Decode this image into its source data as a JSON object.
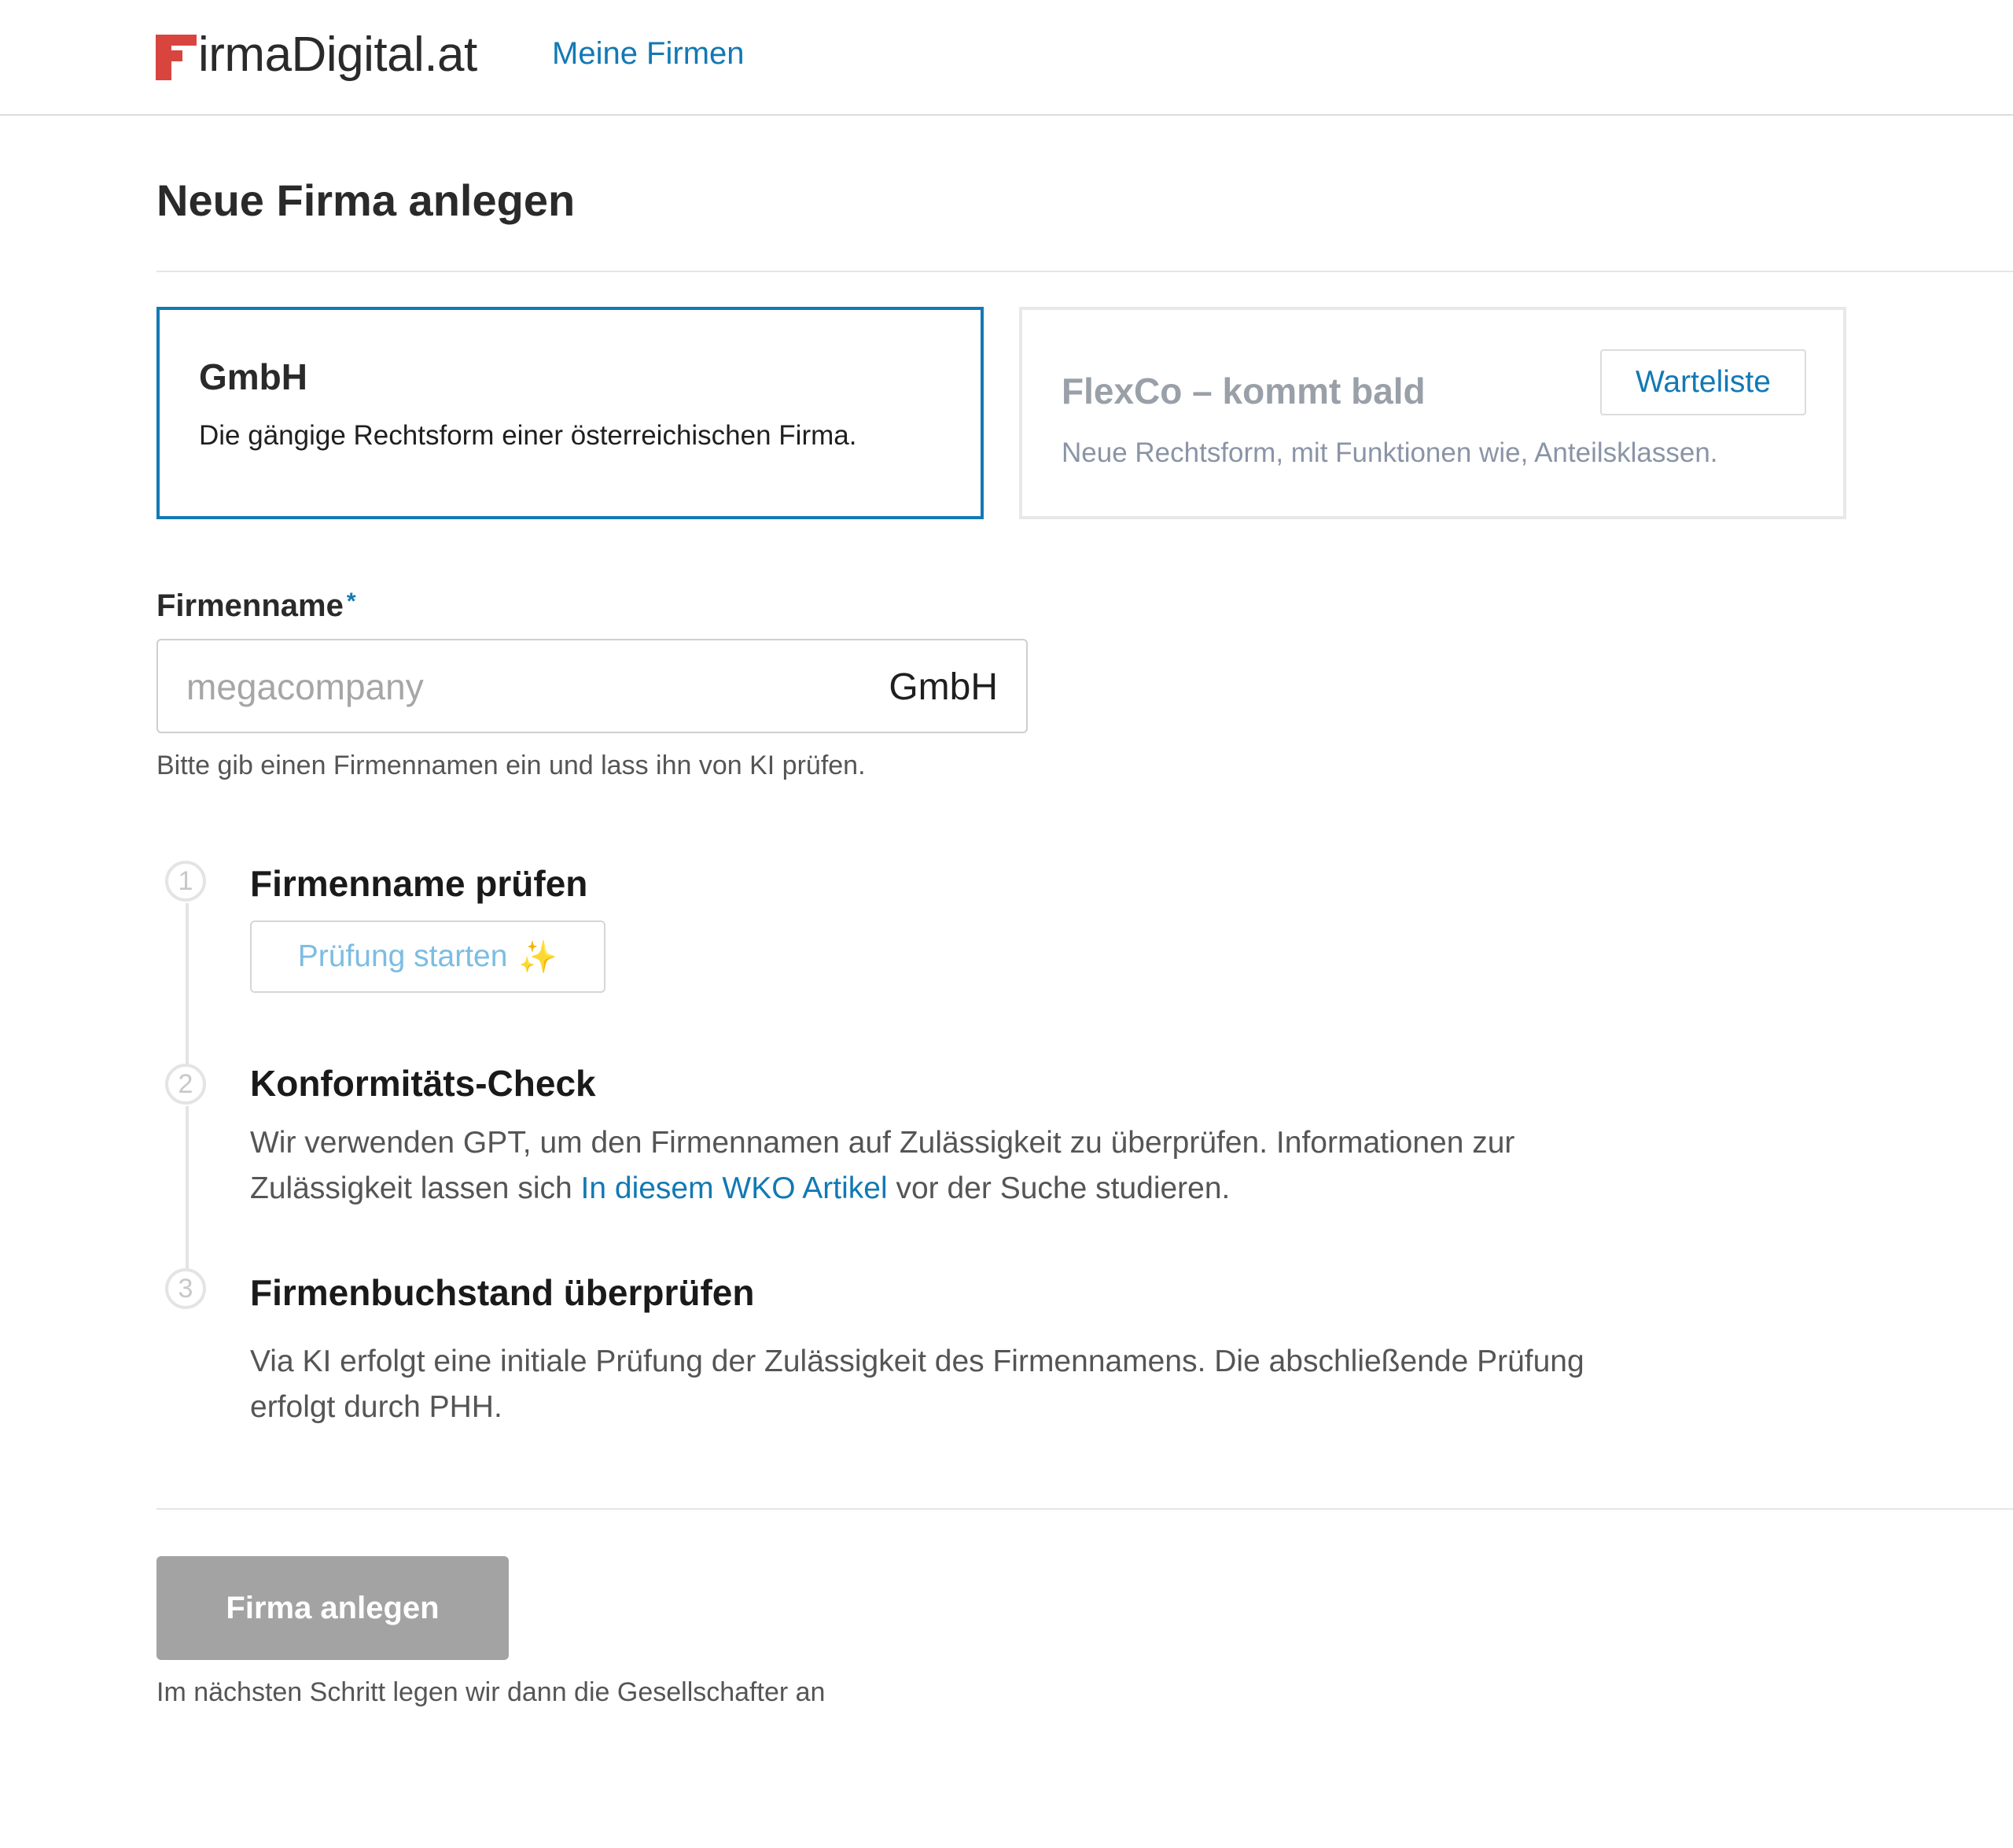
{
  "header": {
    "logo_text": "irmaDigital.at",
    "logo_mark_icon": "firmadigital-f-logo",
    "nav_link": "Meine Firmen"
  },
  "page": {
    "title": "Neue Firma anlegen"
  },
  "legal_forms": {
    "gmbh": {
      "title": "GmbH",
      "description": "Die gängige Rechtsform einer österreichischen Firma.",
      "selected": true
    },
    "flexco": {
      "title": "FlexCo – kommt bald",
      "description": "Neue Rechtsform, mit Funktionen wie, Anteilsklassen.",
      "waitlist_label": "Warteliste"
    }
  },
  "company_name": {
    "label": "Firmenname",
    "required_marker": "*",
    "placeholder": "megacompany",
    "value": "",
    "suffix": "GmbH",
    "help": "Bitte gib einen Firmennamen ein und lass ihn von KI prüfen."
  },
  "steps": [
    {
      "number": "1",
      "title": "Firmenname prüfen",
      "button_label": "Prüfung starten",
      "button_icon": "sparkles-icon"
    },
    {
      "number": "2",
      "title": "Konformitäts-Check",
      "text_before": "Wir verwenden GPT, um den Firmennamen auf Zulässigkeit zu überprüfen. Informationen zur Zulässigkeit lassen sich ",
      "link_text": "In diesem WKO Artikel",
      "text_after": " vor der Suche studieren."
    },
    {
      "number": "3",
      "title": "Firmenbuchstand überprüfen",
      "text": "Via KI erfolgt eine initiale Prüfung der Zulässigkeit des Firmennamens. Die abschließende Prüfung erfolgt durch PHH."
    }
  ],
  "footer": {
    "submit_label": "Firma anlegen",
    "submit_disabled": true,
    "help": "Im nächsten Schritt legen wir dann die Gesellschafter an"
  },
  "colors": {
    "accent": "#1279b4",
    "brand_red": "#d8453f",
    "disabled_button": "#a3a3a3"
  }
}
